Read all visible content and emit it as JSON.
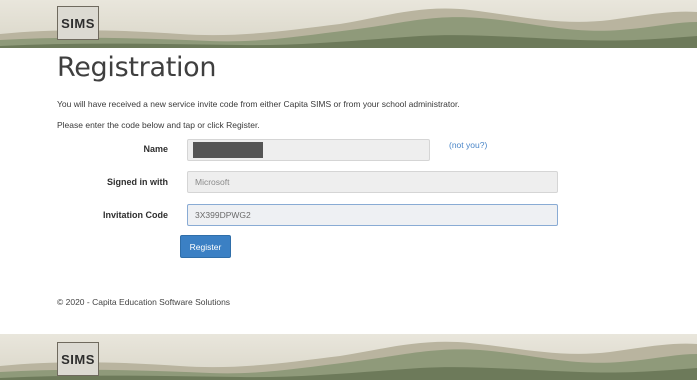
{
  "header": {
    "logo_text": "SIMS"
  },
  "page": {
    "title": "Registration",
    "intro_line1": "You will have received a new service invite code from either Capita SIMS or from your school administrator.",
    "intro_line2": "Please enter the code below and tap or click Register."
  },
  "form": {
    "name_label": "Name",
    "name_value": "",
    "not_you_link": "(not you?)",
    "signed_in_label": "Signed in with",
    "signed_in_value": "Microsoft",
    "invitation_label": "Invitation Code",
    "invitation_value": "3X399DPWG2",
    "register_label": "Register"
  },
  "footer": {
    "copyright": "© 2020 - Capita Education Software Solutions"
  },
  "bottom_banner": {
    "logo_text": "SIMS"
  },
  "colors": {
    "accent": "#3b80c4",
    "link": "#4a86c8",
    "field_bg": "#eeeeee"
  }
}
